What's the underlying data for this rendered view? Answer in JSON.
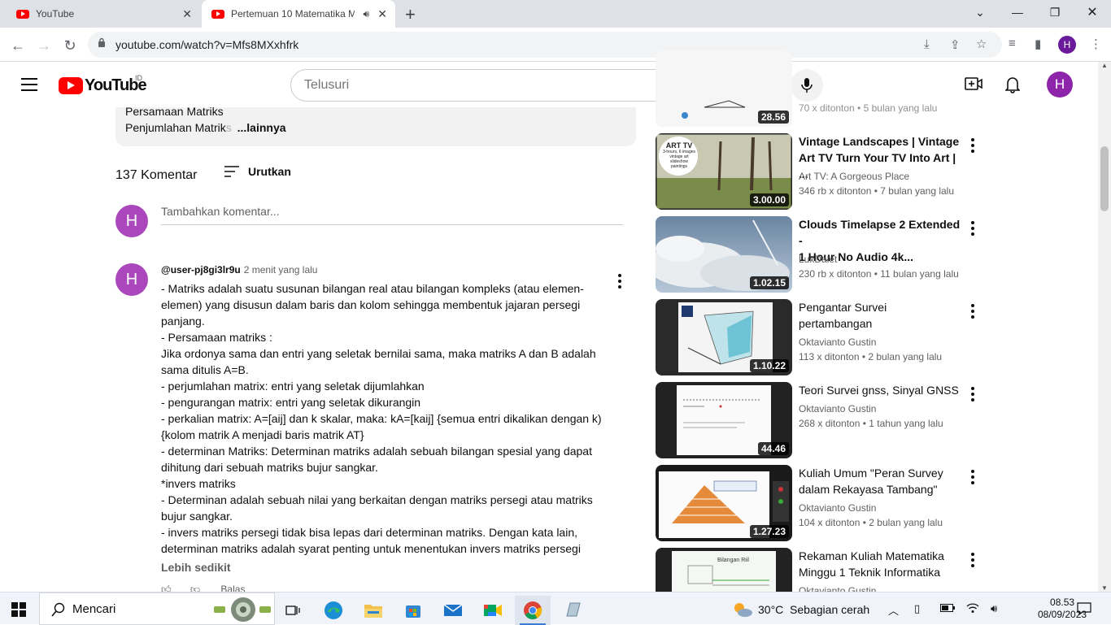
{
  "browser": {
    "tabs": [
      {
        "title": "YouTube"
      },
      {
        "title": "Pertemuan 10 Matematika M"
      }
    ],
    "url": "youtube.com/watch?v=Mfs8MXxhfrk",
    "profile_initial": "H"
  },
  "youtube": {
    "logo_text": "YouTube",
    "country_code": "ID",
    "search_placeholder": "Telusuri",
    "avatar_initial": "H"
  },
  "description": {
    "line1": "Persamaan Matriks",
    "line2_visible": "Penjumlahan Matrik",
    "line2_faded": "s",
    "more_label": "...lainnya"
  },
  "comments": {
    "count_label": "137 Komentar",
    "sort_label": "Urutkan",
    "add_placeholder": "Tambahkan komentar...",
    "user_avatar_initial": "H",
    "items": [
      {
        "avatar_initial": "H",
        "author": "@user-pj8gi3lr9u",
        "time": "2 menit yang lalu",
        "lines": [
          "- Matriks adalah suatu susunan bilangan real atau bilangan kompleks (atau elemen-",
          "elemen) yang disusun dalam baris dan kolom sehingga membentuk jajaran persegi",
          "panjang.",
          "- Persamaan matriks :",
          "Jika ordonya sama dan entri yang seletak bernilai sama, maka matriks A dan B adalah",
          "sama ditulis A=B.",
          "- perjumlahan matrix: entri yang seletak dijumlahkan",
          "- pengurangan matrix: entri yang seletak dikurangin",
          "- perkalian matrix: A=[aij] dan k skalar, maka: kA=[kaij] {semua entri dikalikan dengan k)",
          "{kolom matrik A menjadi baris matrik AT}",
          "- determinan Matriks: Determinan matriks adalah sebuah bilangan spesial yang dapat",
          "dihitung dari sebuah matriks bujur sangkar.",
          "*invers matriks",
          "- Determinan adalah sebuah nilai yang berkaitan dengan matriks persegi atau matriks",
          "bujur sangkar.",
          "- invers matriks persegi tidak bisa lepas dari determinan matriks. Dengan kata lain,",
          "determinan matriks adalah syarat penting untuk menentukan invers matriks persegi"
        ],
        "less_label": "Lebih sedikit",
        "reply_label": "Balas"
      }
    ]
  },
  "recommendations": [
    {
      "title_1": "",
      "title_2": "",
      "channel": "",
      "meta": "70 x ditonton  •  5 bulan yang lalu",
      "duration": "28.56",
      "thumb_color": "#e8e8e8"
    },
    {
      "title_1": "Vintage Landscapes | Vintage",
      "title_2": "Art TV Turn Your TV Into Art | ...",
      "channel": "Art TV: A Gorgeous Place",
      "meta": "346 rb x ditonton  •  7 bulan yang lalu",
      "duration": "3.00.00",
      "thumb_color": "#7a8c5a"
    },
    {
      "title_1": "Clouds Timelapse 2 Extended -",
      "title_2": "1 Hour No Audio 4k...",
      "channel": "LuxDalet",
      "meta": "230 rb x ditonton  •  11 bulan yang lalu",
      "duration": "1.02.15",
      "thumb_color": "#7f98b3"
    },
    {
      "title_1": "Pengantar Survei",
      "title_2": "pertambangan",
      "channel": "Oktavianto Gustin",
      "meta": "113 x ditonton  •  2 bulan yang lalu",
      "duration": "1.10.22",
      "thumb_color": "#d9dde0"
    },
    {
      "title_1": "Teori Survei gnss, Sinyal GNSS",
      "title_2": "",
      "channel": "Oktavianto Gustin",
      "meta": "268 x ditonton  •  1 tahun yang lalu",
      "duration": "44.46",
      "thumb_color": "#f4f4f4"
    },
    {
      "title_1": "Kuliah Umum \"Peran Survey",
      "title_2": "dalam Rekayasa Tambang\"",
      "channel": "Oktavianto Gustin",
      "meta": "104 x ditonton  •  2 bulan yang lalu",
      "duration": "1.27.23",
      "thumb_color": "#f0e6d8"
    },
    {
      "title_1": "Rekaman Kuliah Matematika",
      "title_2": "Minggu 1 Teknik Informatika",
      "channel": "Oktavianto Gustin",
      "meta": "",
      "duration": "",
      "thumb_color": "#e9eef0"
    }
  ],
  "thumb_text": {
    "arttv_title": "ART TV",
    "arttv_sub1": "3-hours, 6 images",
    "arttv_sub2": "vintage art",
    "arttv_sub3": "slideshow",
    "arttv_sub4": "paintings",
    "rekaman_label": "Bilangan Riil"
  },
  "taskbar": {
    "search_label": "Mencari",
    "weather": "30°C  Sebagian cerah",
    "time": "08.53",
    "date": "08/09/2023"
  },
  "colors": {
    "youtube_red": "#ff0000",
    "avatar_purple": "#8e24aa",
    "taskbar_accent": "#3a7bd5"
  }
}
